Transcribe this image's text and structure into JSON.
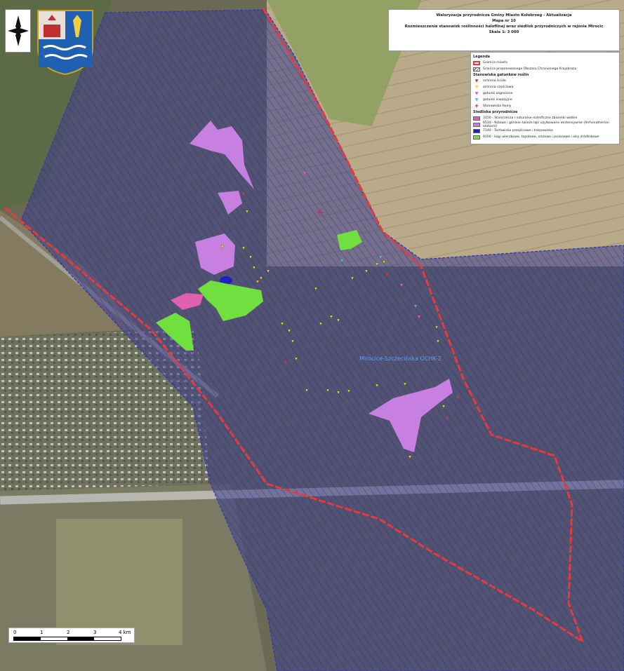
{
  "title": {
    "line1": "Waloryzacja przyrodnicza Gminy Miasto Kołobrzeg - Aktualizacja",
    "line2": "Mapa nr 10",
    "line3": "Rozmieszczenie stanowisk roślinności halofilnej wraz siedlisk przyrodniczych w rejonie Mirocic",
    "line4": "Skala 1: 3 000"
  },
  "legend": {
    "heading": "Legenda",
    "boundary_items": [
      {
        "label": "Granica miasta",
        "color": "#e83a3a"
      },
      {
        "label": "Granica proponowanego Obszaru Chronionego Krajobrazu",
        "color": "#3a3aa8"
      }
    ],
    "species_heading": "Stanowiska gatunków roślin",
    "species_items": [
      {
        "label": "ochrona ścisła",
        "color": "#e03030",
        "icon": "triangle-down"
      },
      {
        "label": "ochrona częściowa",
        "color": "#f0e020",
        "icon": "triangle-down"
      },
      {
        "label": "gatunki zagrożone",
        "color": "#e050e0",
        "icon": "triangle-down"
      },
      {
        "label": "gatunki inwazyjne",
        "color": "#40c0d0",
        "icon": "triangle-down"
      },
      {
        "label": "Stanowiska fauny",
        "color": "#c03050",
        "icon": "cross"
      }
    ],
    "habitat_heading": "Siedliska przyrodnicze",
    "habitat_items": [
      {
        "label": "3150 - Starorzecza i naturalne eutroficzne zbiorniki wodne",
        "color": "#e060b0"
      },
      {
        "label": "6510 - Niżowe i górskie świeże łąki użytkowane ekstensywnie (Arrhenatherion elatioris)",
        "color": "#c880e0"
      },
      {
        "label": "7140 - Torfowiska przejściowe i trzęsawiska",
        "color": "#2020c0"
      },
      {
        "label": "9100 - Łęgi wierzbowe, topolowe, olszowe i jesionowe i olsy źródliskowe",
        "color": "#70e040"
      }
    ]
  },
  "map": {
    "area_label": "Mirocice-Szczecińska OCHK-2"
  },
  "scale": {
    "ticks": [
      "0",
      "1",
      "2",
      "3",
      "4 km"
    ]
  },
  "colors": {
    "hatch": "#2a2aa0",
    "boundary_red": "#e83a3a",
    "boundary_blue": "#3a3aa8"
  }
}
